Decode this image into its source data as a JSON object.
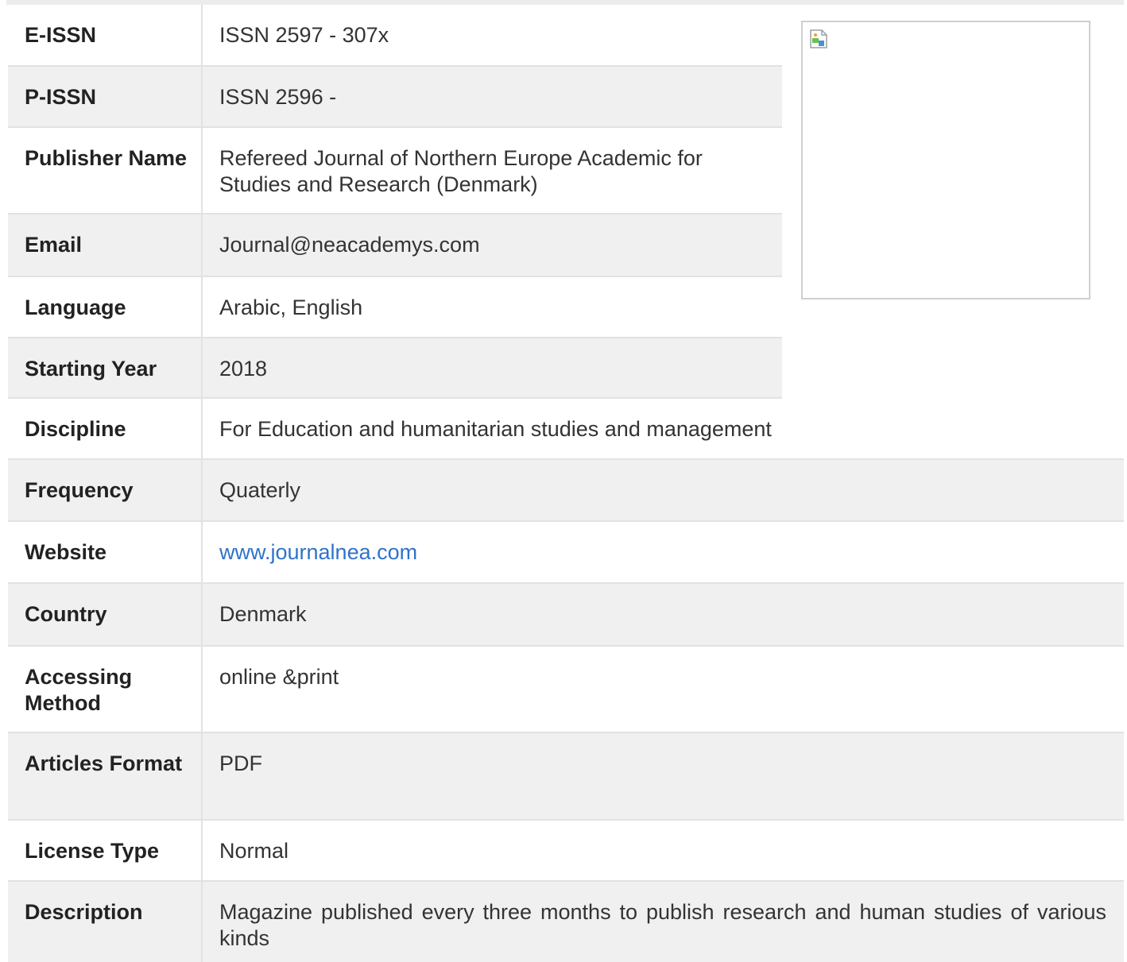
{
  "journal_info": {
    "rows": [
      {
        "label": "E-ISSN",
        "value": "ISSN 2597 - 307x"
      },
      {
        "label": "P-ISSN",
        "value": "ISSN 2596 -"
      },
      {
        "label": "Publisher Name",
        "value": "Refereed Journal of Northern Europe Academic for Studies and Research (Denmark)"
      },
      {
        "label": "Email",
        "value": "Journal@neacademys.com"
      },
      {
        "label": "Language",
        "value": "Arabic, English"
      },
      {
        "label": "Starting Year",
        "value": "2018"
      },
      {
        "label": "Discipline",
        "value": "For Education and humanitarian studies and management"
      },
      {
        "label": "Frequency",
        "value": "Quaterly"
      },
      {
        "label": "Website",
        "value": "www.journalnea.com"
      },
      {
        "label": "Country",
        "value": "Denmark"
      },
      {
        "label": "Accessing Method",
        "value": "online &print"
      },
      {
        "label": "Articles Format",
        "value": "PDF"
      },
      {
        "label": "License Type",
        "value": "Normal"
      },
      {
        "label": "Description",
        "value": "Magazine published every three months to publish research and human studies of various kinds"
      }
    ],
    "cover_image": {
      "icon": "broken-image-icon"
    },
    "link_color": "#2f73c9"
  }
}
